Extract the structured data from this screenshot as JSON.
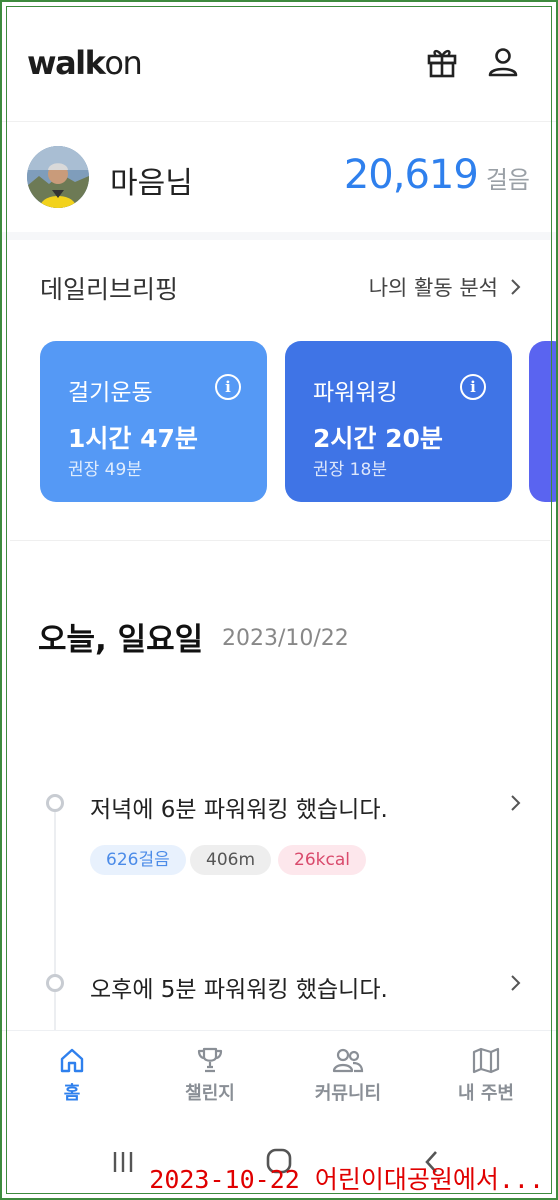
{
  "header": {
    "logo_bold": "walk",
    "logo_light": "on",
    "gift_icon": "gift-icon",
    "profile_icon": "user-icon"
  },
  "profile": {
    "name": "마음님",
    "steps": "20,619",
    "steps_unit": "걸음"
  },
  "briefing": {
    "title": "데일리브리핑",
    "link": "나의 활동 분석",
    "cards": [
      {
        "title": "걸기운동",
        "value": "1시간 47분",
        "sub": "권장 49분",
        "color": "#5599f5"
      },
      {
        "title": "파워워킹",
        "value": "2시간 20분",
        "sub": "권장 18분",
        "color": "#3f74e6"
      }
    ],
    "third_card_color": "#5a64f0"
  },
  "today": {
    "title": "오늘, 일요일",
    "date": "2023/10/22"
  },
  "activities": [
    {
      "text": "저녁에 6분 파워워킹 했습니다.",
      "tags": [
        {
          "label": "626걸음",
          "bg": "#e8f1fd",
          "fg": "#4b8be8"
        },
        {
          "label": "406m",
          "bg": "#eeeeee",
          "fg": "#555555"
        },
        {
          "label": "26kcal",
          "bg": "#fde7ec",
          "fg": "#d94a6c"
        }
      ]
    },
    {
      "text": "오후에 5분 파워워킹 했습니다."
    }
  ],
  "nav": {
    "items": [
      {
        "label": "홈",
        "icon": "home-icon",
        "active": true
      },
      {
        "label": "챌린지",
        "icon": "trophy-icon"
      },
      {
        "label": "커뮤니티",
        "icon": "people-icon"
      },
      {
        "label": "내 주변",
        "icon": "map-icon"
      }
    ],
    "active_color": "#2f80ed",
    "inactive_color": "#8a8f96"
  },
  "caption": "2023-10-22 어린이대공원에서..."
}
